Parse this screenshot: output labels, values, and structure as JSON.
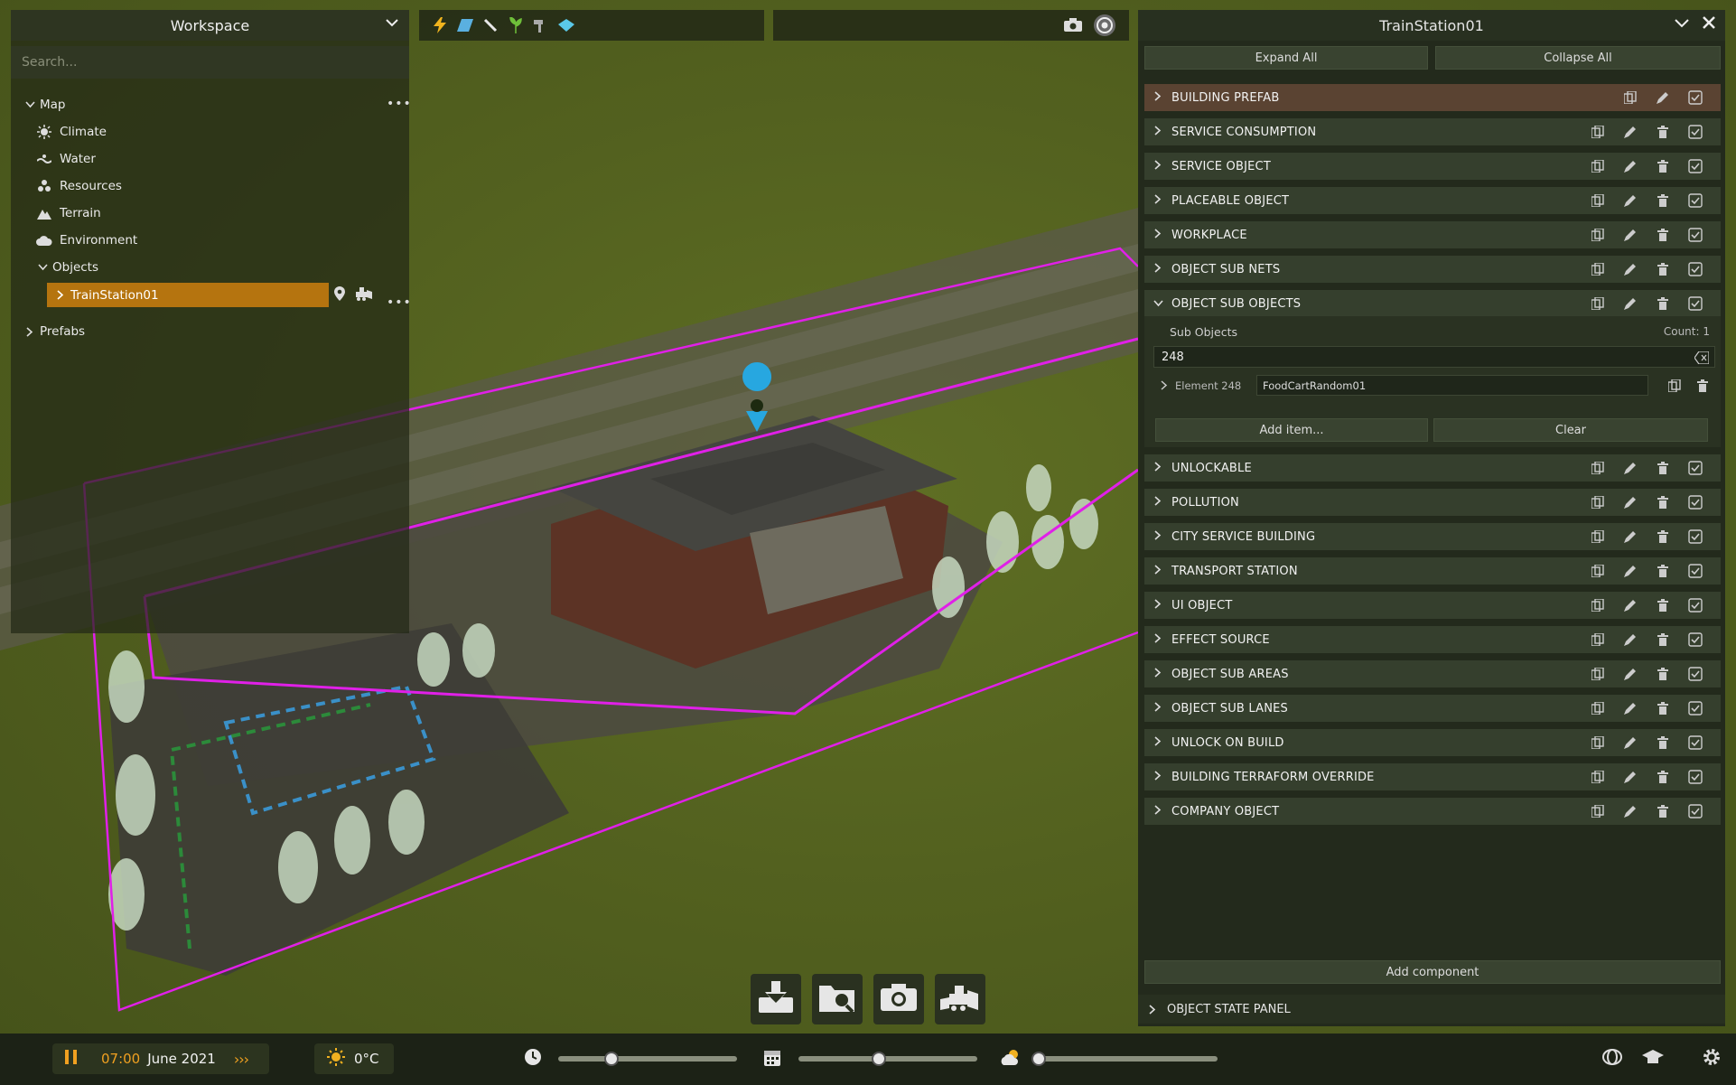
{
  "workspace": {
    "title": "Workspace",
    "search_placeholder": "Search...",
    "tree": {
      "map_label": "Map",
      "items": [
        {
          "label": "Climate",
          "icon": "sun-icon"
        },
        {
          "label": "Water",
          "icon": "water-icon"
        },
        {
          "label": "Resources",
          "icon": "resources-icon"
        },
        {
          "label": "Terrain",
          "icon": "mountain-icon"
        },
        {
          "label": "Environment",
          "icon": "cloud-icon"
        }
      ],
      "objects_label": "Objects",
      "selected_object": "TrainStation01",
      "prefabs_label": "Prefabs"
    }
  },
  "inspector": {
    "title": "TrainStation01",
    "expand_all": "Expand All",
    "collapse_all": "Collapse All",
    "components": [
      "BUILDING PREFAB",
      "SERVICE CONSUMPTION",
      "SERVICE OBJECT",
      "PLACEABLE OBJECT",
      "WORKPLACE",
      "OBJECT SUB NETS",
      "OBJECT SUB OBJECTS",
      "UNLOCKABLE",
      "POLLUTION",
      "CITY SERVICE BUILDING",
      "TRANSPORT STATION",
      "UI OBJECT",
      "EFFECT SOURCE",
      "OBJECT SUB AREAS",
      "OBJECT SUB LANES",
      "UNLOCK ON BUILD",
      "BUILDING TERRAFORM OVERRIDE",
      "COMPANY OBJECT"
    ],
    "sub_objects": {
      "label": "Sub Objects",
      "count": "Count: 1",
      "search_value": "248",
      "element_label": "Element 248",
      "element_value": "FoodCartRandom01",
      "add_item": "Add item...",
      "clear": "Clear"
    },
    "add_component": "Add component",
    "object_state_panel": "OBJECT STATE PANEL"
  },
  "bottom": {
    "time": "07:00",
    "date": "June 2021",
    "temperature": "0°C",
    "speed_label": "›››",
    "time_slider": 0.3,
    "date_slider": 0.45,
    "weather_slider": 0.0
  },
  "colors": {
    "accent": "#b5740f",
    "boundary": "#e020e8",
    "marker": "#27a7e0"
  }
}
